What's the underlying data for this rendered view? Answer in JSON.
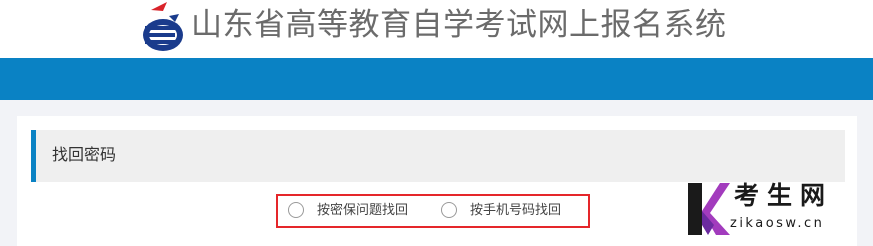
{
  "header": {
    "site_title": "山东省高等教育自学考试网上报名系统",
    "logo_icon": "exam-logo-icon"
  },
  "navbar": {
    "color": "#0a82c4"
  },
  "panel": {
    "heading": "找回密码",
    "accent": "#0a82c4"
  },
  "recovery_options": {
    "highlight_color": "#e5262a",
    "items": [
      {
        "label": "按密保问题找回",
        "selected": false
      },
      {
        "label": "按手机号码找回",
        "selected": false
      }
    ]
  },
  "watermark": {
    "brand_text": "考生网",
    "url": "zikaosw.cn",
    "logo_icon": "k-brand-icon"
  }
}
